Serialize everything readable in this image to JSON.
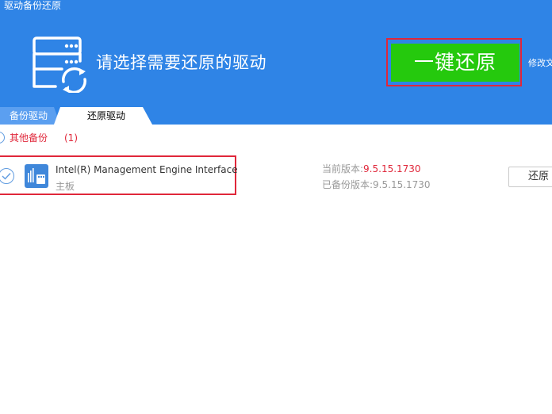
{
  "window": {
    "title": "驱动备份还原"
  },
  "hero": {
    "heading": "请选择需要还原的驱动",
    "restore_all_label": "一键还原",
    "modify_link": "修改文"
  },
  "tabs": [
    {
      "label": "备份驱动",
      "active": false
    },
    {
      "label": "还原驱动",
      "active": true
    }
  ],
  "group": {
    "label": "其他备份",
    "count": "(1)"
  },
  "drivers": [
    {
      "name": "Intel(R) Management Engine Interface",
      "category": "主板",
      "current_version_label": "当前版本:",
      "current_version": "9.5.15.1730",
      "backup_version_label": "已备份版本:",
      "backup_version": "9.5.15.1730",
      "restore_label": "还原"
    }
  ],
  "colors": {
    "header_bg": "#2f84e6",
    "primary_button": "#25c90d",
    "highlight_border": "#e0273a",
    "red_text": "#e0273a"
  }
}
